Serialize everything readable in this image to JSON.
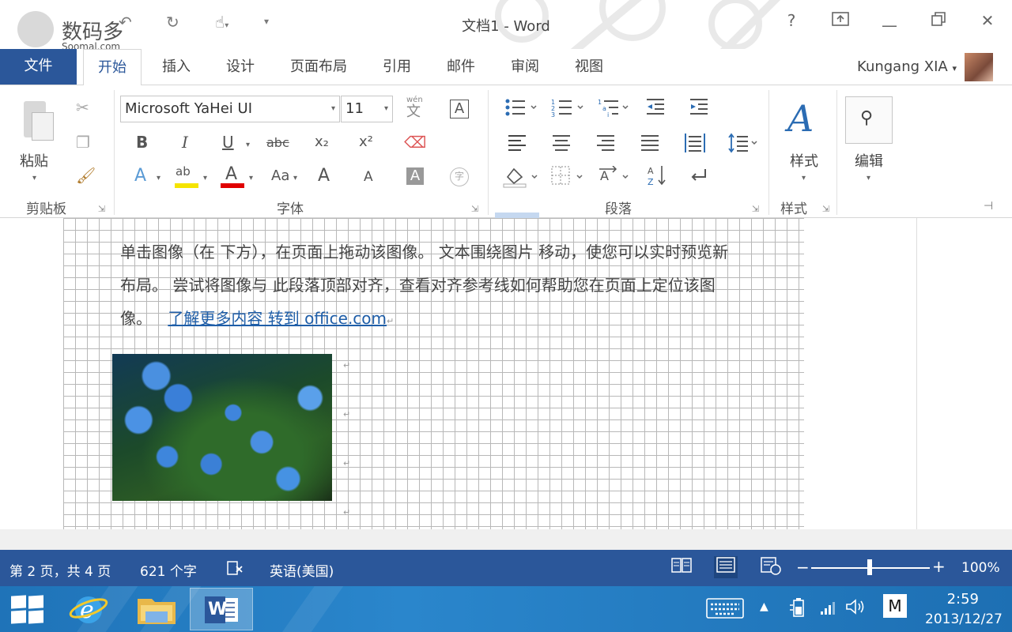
{
  "window": {
    "title": "文档1 - Word",
    "help": "?",
    "minimize": "—",
    "close": "✕"
  },
  "watermark": {
    "name": "数码多",
    "site": "Soomal.com"
  },
  "tabs": {
    "file": "文件",
    "items": [
      "开始",
      "插入",
      "设计",
      "页面布局",
      "引用",
      "邮件",
      "审阅",
      "视图"
    ],
    "active_index": 0
  },
  "user": {
    "name": "Kungang XIA",
    "dropdown": "▾"
  },
  "ribbon": {
    "clipboard": {
      "paste_label": "粘贴",
      "group_label": "剪贴板"
    },
    "font": {
      "font_name": "Microsoft YaHei UI",
      "font_size": "11",
      "group_label": "字体",
      "bold": "B",
      "italic": "I",
      "underline": "U",
      "strike": "abc",
      "subscript": "x₂",
      "superscript": "x²",
      "text_effect": "A",
      "highlight": "ab",
      "font_color": "A",
      "change_case": "Aa",
      "grow": "A",
      "shrink": "A",
      "char_shading": "A",
      "enclose": "字",
      "phonetic_top": "wén",
      "phonetic": "文",
      "char_border": "A",
      "highlight_color": "#f5e400",
      "font_color_value": "#e00000"
    },
    "paragraph": {
      "group_label": "段落"
    },
    "styles": {
      "label": "样式",
      "group_label": "样式"
    },
    "editing": {
      "label": "编辑"
    }
  },
  "document": {
    "lines": [
      "单击图像（在 下方），在页面上拖动该图像。 文本围绕图片 移动，使您可以实时预览新",
      "布局。 尝试将图像与 此段落顶部对齐，查看对齐参考线如何帮助您在页面上定位该图",
      "像。"
    ],
    "link_text": "了解更多内容 转到 office.com",
    "paragraph_mark": "↵"
  },
  "statusbar": {
    "page": "第 2 页，共 4 页",
    "words": "621 个字",
    "language": "英语(美国)",
    "zoom": "100%",
    "zoom_minus": "−",
    "zoom_plus": "+"
  },
  "taskbar": {
    "time": "2:59",
    "date": "2013/12/27",
    "ime": "M",
    "word_icon": "W"
  },
  "colors": {
    "accent": "#2b579a",
    "taskbar": "#2a86cc",
    "link": "#1f5ea8"
  }
}
